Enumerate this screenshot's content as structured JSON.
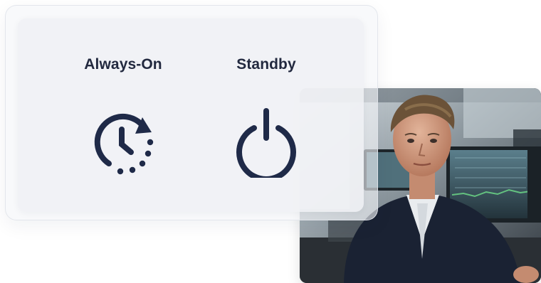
{
  "modes": [
    {
      "label": "Always-On",
      "icon": "clock-refresh-icon"
    },
    {
      "label": "Standby",
      "icon": "power-icon"
    }
  ],
  "photo": {
    "icon": "person-at-trading-desk-photo"
  },
  "colors": {
    "icon": "#1f2a48",
    "label": "#22293f",
    "card": "#f0f1f5",
    "page": "#ffffff"
  }
}
